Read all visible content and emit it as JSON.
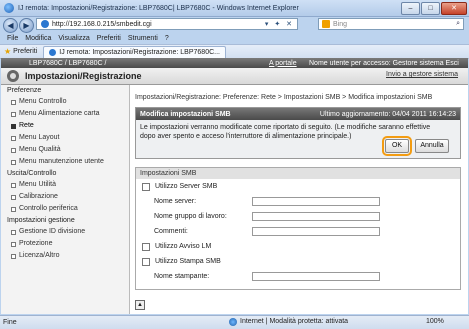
{
  "window": {
    "title": "IJ remota: Impostazioni/Registrazione: LBP7680C| LBP7680C - Windows Internet Explorer",
    "minimize": "–",
    "maximize": "□",
    "close": "✕"
  },
  "address": {
    "url": "http://192.168.0.215/smbedit.cgi",
    "tools": "▾ ✦ ✕",
    "search_placeholder": "Bing"
  },
  "menu": {
    "items": [
      "File",
      "Modifica",
      "Visualizza",
      "Preferiti",
      "Strumenti",
      "?"
    ]
  },
  "favorites": {
    "label": "Preferiti",
    "tab_title": "IJ remota: Impostazioni/Registrazione: LBP7680C..."
  },
  "header": {
    "model": "LBP7680C / LBP7680C /",
    "portal_link": "A portale",
    "user_info": "Nome utente per accesso: Gestore sistema Esci",
    "page_title": "Impostazioni/Registrazione",
    "sysadmin_link": "Invio a gestore sistema"
  },
  "sidebar": {
    "sections": [
      {
        "title": "Preferenze",
        "items": [
          {
            "label": "Menu Controllo",
            "active": false
          },
          {
            "label": "Menu Alimentazione carta",
            "active": false
          },
          {
            "label": "Rete",
            "active": true
          },
          {
            "label": "Menu Layout",
            "active": false
          },
          {
            "label": "Menu Qualità",
            "active": false
          },
          {
            "label": "Menu manutenzione utente",
            "active": false
          }
        ]
      },
      {
        "title": "Uscita/Controllo",
        "items": [
          {
            "label": "Menu Utilità",
            "active": false
          },
          {
            "label": "Calibrazione",
            "active": false
          },
          {
            "label": "Controllo periferica",
            "active": false
          }
        ]
      },
      {
        "title": "Impostazioni gestione",
        "items": [
          {
            "label": "Gestione ID divisione",
            "active": false
          },
          {
            "label": "Protezione",
            "active": false
          },
          {
            "label": "Licenza/Altro",
            "active": false
          }
        ]
      }
    ]
  },
  "main": {
    "breadcrumb": "Impostazioni/Registrazione: Preferenze: Rete > Impostazioni SMB > Modifica impostazioni SMB",
    "modal": {
      "title": "Modifica impostazioni SMB",
      "updated": "Ultimo aggiornamento: 04/04 2011 16:14:23",
      "message": "Le impostazioni verranno modificate come riportato di seguito. (Le modifiche saranno effettive dopo aver spento e acceso l'interruttore di alimentazione principale.)",
      "ok_label": "OK",
      "cancel_label": "Annulla"
    },
    "section": {
      "title": "Impostazioni SMB",
      "server_checkbox": "Utilizzo Server SMB",
      "server_name_label": "Nome server:",
      "workgroup_label": "Nome gruppo di lavoro:",
      "comments_label": "Commenti:",
      "lm_checkbox": "Utilizzo Avviso LM",
      "print_checkbox": "Utilizzo Stampa SMB",
      "printer_name_label": "Nome stampante:"
    }
  },
  "status": {
    "left": "Fine",
    "zone": "Internet | Modalità protetta: attivata",
    "zoom": "100%"
  }
}
